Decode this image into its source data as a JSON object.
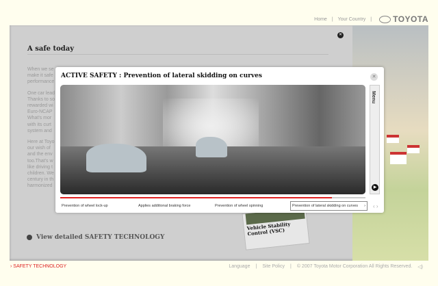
{
  "header": {
    "home": "Home",
    "country": "Your Country",
    "brand": "TOYOTA"
  },
  "page": {
    "title": "A safe today",
    "body": [
      [
        "When we se",
        "make it safe",
        "performance"
      ],
      [
        "One car lead",
        "Thanks to so",
        "rewarded wi",
        "Euro-NCAP",
        "What's mor",
        "with its curt",
        "system and"
      ],
      [
        "Here at Toyo",
        "our wish of",
        "and the env",
        "too.That's w",
        "like driving t",
        "children. We",
        "century in th",
        "harmonized"
      ]
    ],
    "detail_link": "View detailed SAFETY TECHNOLOGY",
    "card": "Vehicle Stability Control (VSC)"
  },
  "modal": {
    "title": "ACTIVE SAFETY : Prevention of lateral skidding on curves",
    "menu": "Menu",
    "progress": 0.89,
    "tabs": [
      "Prevention of wheel lock-up",
      "Applies additional braking force",
      "Prevention of wheel spinning",
      "Prevention of lateral skidding on curves"
    ],
    "active_tab": 3
  },
  "footer": {
    "breadcrumb": "› SAFETY TECHNOLOGY",
    "language": "Language",
    "policy": "Site Policy",
    "copyright": "© 2007 Toyota Motor Corporation All Rights Reserved."
  }
}
